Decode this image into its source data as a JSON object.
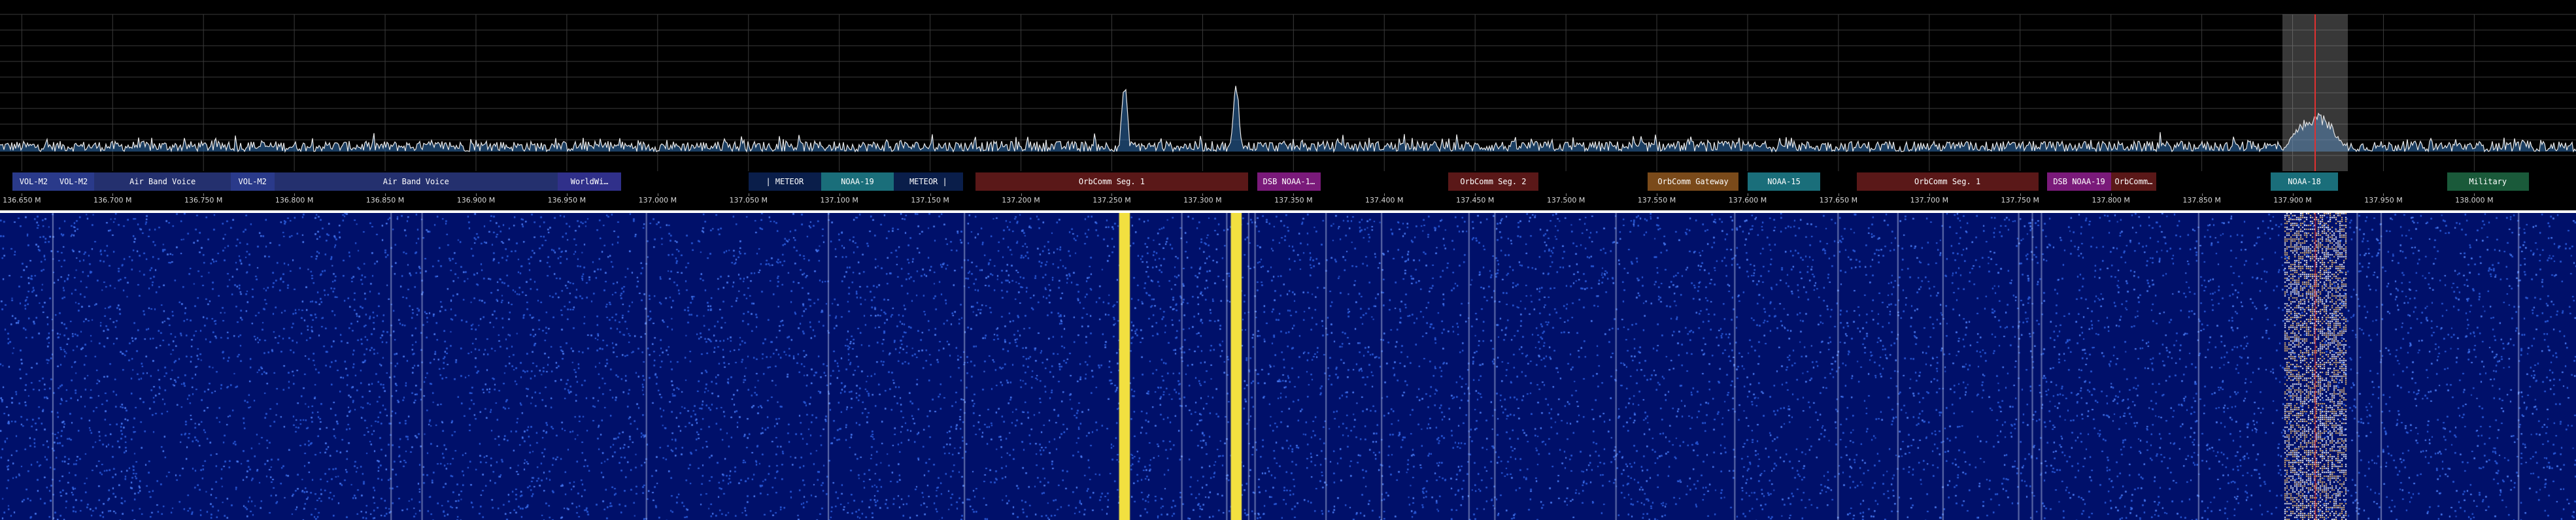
{
  "bandplan": [
    {
      "label": "VOL-M2",
      "start": 136.645,
      "end": 136.668,
      "color": "#2a3a8a",
      "text": "#ffffff"
    },
    {
      "label": "VOL-M2",
      "start": 136.667,
      "end": 136.69,
      "color": "#2a3a8a",
      "text": "#ffffff"
    },
    {
      "label": "Air Band Voice",
      "start": 136.69,
      "end": 136.765,
      "color": "#24306e",
      "text": "#ffffff"
    },
    {
      "label": "VOL-M2",
      "start": 136.765,
      "end": 136.789,
      "color": "#2a3a8a",
      "text": "#ffffff"
    },
    {
      "label": "Air Band Voice",
      "start": 136.789,
      "end": 136.945,
      "color": "#24306e",
      "text": "#ffffff"
    },
    {
      "label": "WorldWi…",
      "start": 136.945,
      "end": 136.98,
      "color": "#30308a",
      "text": "#ffffff"
    },
    {
      "label": "| METEOR",
      "start": 137.05,
      "end": 137.09,
      "color": "#0a1e4a",
      "text": "#ffffff"
    },
    {
      "label": "NOAA-19",
      "start": 137.09,
      "end": 137.13,
      "color": "#1a6e7a",
      "text": "#ffffff"
    },
    {
      "label": "METEOR |",
      "start": 137.13,
      "end": 137.168,
      "color": "#0a1e4a",
      "text": "#ffffff"
    },
    {
      "label": "OrbComm Seg. 1",
      "start": 137.175,
      "end": 137.325,
      "color": "#5a1818",
      "text": "#ffffff"
    },
    {
      "label": "DSB NOAA-1…",
      "start": 137.33,
      "end": 137.365,
      "color": "#7a1a7a",
      "text": "#ffffff"
    },
    {
      "label": "OrbComm Seg. 2",
      "start": 137.435,
      "end": 137.485,
      "color": "#5a1818",
      "text": "#ffffff"
    },
    {
      "label": "OrbComm Gateway",
      "start": 137.545,
      "end": 137.595,
      "color": "#7a4a1a",
      "text": "#ffffff"
    },
    {
      "label": "NOAA-15",
      "start": 137.6,
      "end": 137.64,
      "color": "#1a6e7a",
      "text": "#ffffff"
    },
    {
      "label": "OrbComm Seg. 1",
      "start": 137.66,
      "end": 137.76,
      "color": "#5a1818",
      "text": "#ffffff"
    },
    {
      "label": "DSB NOAA-19",
      "start": 137.765,
      "end": 137.8,
      "color": "#7a1a7a",
      "text": "#ffffff"
    },
    {
      "label": "OrbComm…",
      "start": 137.8,
      "end": 137.825,
      "color": "#5a1818",
      "text": "#ffffff"
    },
    {
      "label": "NOAA-18",
      "start": 137.888,
      "end": 137.925,
      "color": "#1a6e7a",
      "text": "#ffffff"
    },
    {
      "label": "Military",
      "start": 137.985,
      "end": 138.03,
      "color": "#1a5a3a",
      "text": "#ffffff"
    }
  ],
  "axis": {
    "start_mhz": 136.638,
    "end_mhz": 138.056,
    "ticks": [
      {
        "value": 136.65,
        "label": "136.650 M"
      },
      {
        "value": 136.7,
        "label": "136.700 M"
      },
      {
        "value": 136.75,
        "label": "136.750 M"
      },
      {
        "value": 136.8,
        "label": "136.800 M"
      },
      {
        "value": 136.85,
        "label": "136.850 M"
      },
      {
        "value": 136.9,
        "label": "136.900 M"
      },
      {
        "value": 136.95,
        "label": "136.950 M"
      },
      {
        "value": 137.0,
        "label": "137.000 M"
      },
      {
        "value": 137.05,
        "label": "137.050 M"
      },
      {
        "value": 137.1,
        "label": "137.100 M"
      },
      {
        "value": 137.15,
        "label": "137.150 M"
      },
      {
        "value": 137.2,
        "label": "137.200 M"
      },
      {
        "value": 137.25,
        "label": "137.250 M"
      },
      {
        "value": 137.3,
        "label": "137.300 M"
      },
      {
        "value": 137.35,
        "label": "137.350 M"
      },
      {
        "value": 137.4,
        "label": "137.400 M"
      },
      {
        "value": 137.45,
        "label": "137.450 M"
      },
      {
        "value": 137.5,
        "label": "137.500 M"
      },
      {
        "value": 137.55,
        "label": "137.550 M"
      },
      {
        "value": 137.6,
        "label": "137.600 M"
      },
      {
        "value": 137.65,
        "label": "137.650 M"
      },
      {
        "value": 137.7,
        "label": "137.700 M"
      },
      {
        "value": 137.75,
        "label": "137.750 M"
      },
      {
        "value": 137.8,
        "label": "137.800 M"
      },
      {
        "value": 137.85,
        "label": "137.850 M"
      },
      {
        "value": 137.9,
        "label": "137.900 M"
      },
      {
        "value": 137.95,
        "label": "137.950 M"
      },
      {
        "value": 138.0,
        "label": "138.000 M"
      }
    ]
  },
  "tuned": {
    "center_mhz": 137.9125,
    "bandwidth_mhz": 0.036
  },
  "signals": [
    {
      "center_mhz": 137.257,
      "width_mhz": 0.006,
      "strength": 0.85,
      "color": "#f2e040"
    },
    {
      "center_mhz": 137.3185,
      "width_mhz": 0.006,
      "strength": 0.85,
      "color": "#f2e040"
    },
    {
      "center_mhz": 137.9125,
      "width_mhz": 0.034,
      "strength": 0.6,
      "color": "#ffffff"
    }
  ],
  "colors": {
    "spectrum_line": "#e8e8e8",
    "spectrum_fill": "#2f6fb0",
    "grid": "#3a3a3a",
    "waterfall_bg": "#00106a",
    "waterfall_noise": "#2a5ad8",
    "strong_signal": "#f2e040"
  }
}
